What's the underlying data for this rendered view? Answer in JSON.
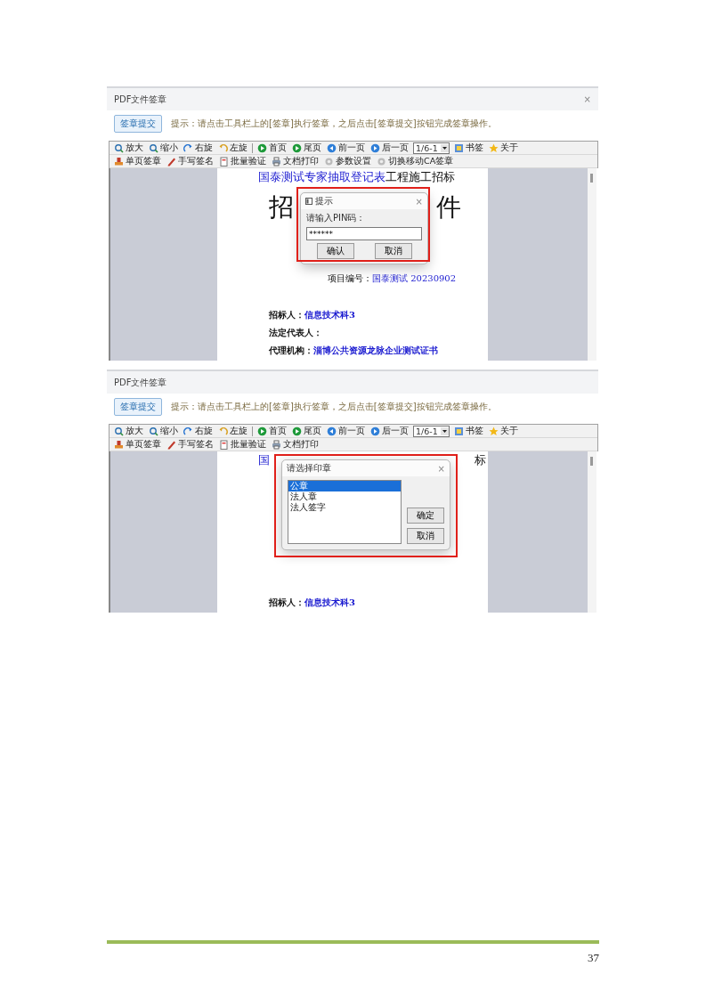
{
  "screenshots": [
    {
      "window_title": "PDF文件签章",
      "close": "×",
      "submit_button": "签章提交",
      "hint": "提示：请点击工具栏上的[签章]执行签章，之后点击[签章提交]按钮完成签章操作。",
      "toolbar": [
        {
          "label": "放大"
        },
        {
          "label": "缩小"
        },
        {
          "label": "右旋"
        },
        {
          "label": "左旋"
        },
        {
          "label": "首页"
        },
        {
          "label": "尾页"
        },
        {
          "label": "前一页"
        },
        {
          "label": "后一页"
        }
      ],
      "page_select": "1/6-1",
      "toolbar_end": [
        {
          "label": "书签"
        },
        {
          "label": "关于"
        }
      ],
      "toolbar_2": [
        {
          "label": "单页签章"
        },
        {
          "label": "手写签名"
        },
        {
          "label": "批量验证"
        },
        {
          "label": "文档打印"
        },
        {
          "label": "参数设置"
        },
        {
          "label": "切换移动CA签章"
        }
      ],
      "document": {
        "heading_left": [
          {
            "text": "国泰测试专家抽取登记表",
            "field": true
          },
          {
            "text": "工程施工招标",
            "field": false
          }
        ],
        "big_left": "招",
        "big_right": "件",
        "project": {
          "label": "项目编号：",
          "value": "国泰测试 20230902"
        },
        "lines": [
          {
            "label": "招标人：",
            "value": "信息技术科3"
          },
          {
            "label": "法定代表人："
          },
          {
            "label": "代理机构：",
            "value": "淄博公共资源龙脉企业测试证书"
          }
        ]
      },
      "dialog": {
        "kind": "pin",
        "title": "提示",
        "close": "×",
        "label": "请输入PIN码：",
        "value": "******",
        "buttons": [
          "确认",
          "取消"
        ]
      }
    },
    {
      "window_title": "PDF文件签章",
      "submit_button": "签章提交",
      "hint": "提示：请点击工具栏上的[签章]执行签章，之后点击[签章提交]按钮完成签章操作。",
      "toolbar": [
        {
          "label": "放大"
        },
        {
          "label": "缩小"
        },
        {
          "label": "右旋"
        },
        {
          "label": "左旋"
        },
        {
          "label": "首页"
        },
        {
          "label": "尾页"
        },
        {
          "label": "前一页"
        },
        {
          "label": "后一页"
        }
      ],
      "page_select": "1/6-1",
      "toolbar_end": [
        {
          "label": "书签"
        },
        {
          "label": "关于"
        }
      ],
      "toolbar_2": [
        {
          "label": "单页签章"
        },
        {
          "label": "手写签名"
        },
        {
          "label": "批量验证"
        },
        {
          "label": "文档打印"
        }
      ],
      "document": {
        "heading_left": [
          {
            "text": "国",
            "field": true
          }
        ],
        "heading_right": [
          {
            "text": "标",
            "field": false
          }
        ],
        "lines": [
          {
            "label": "招标人：",
            "value": "信息技术科3"
          }
        ]
      },
      "dialog": {
        "kind": "seal",
        "title": "请选择印章",
        "close": "×",
        "items": [
          {
            "text": "公章",
            "selected": true
          },
          {
            "text": "法人章",
            "selected": false
          },
          {
            "text": "法人签字",
            "selected": false
          }
        ],
        "buttons": [
          "确定",
          "取消"
        ]
      }
    }
  ],
  "page_number": "37"
}
